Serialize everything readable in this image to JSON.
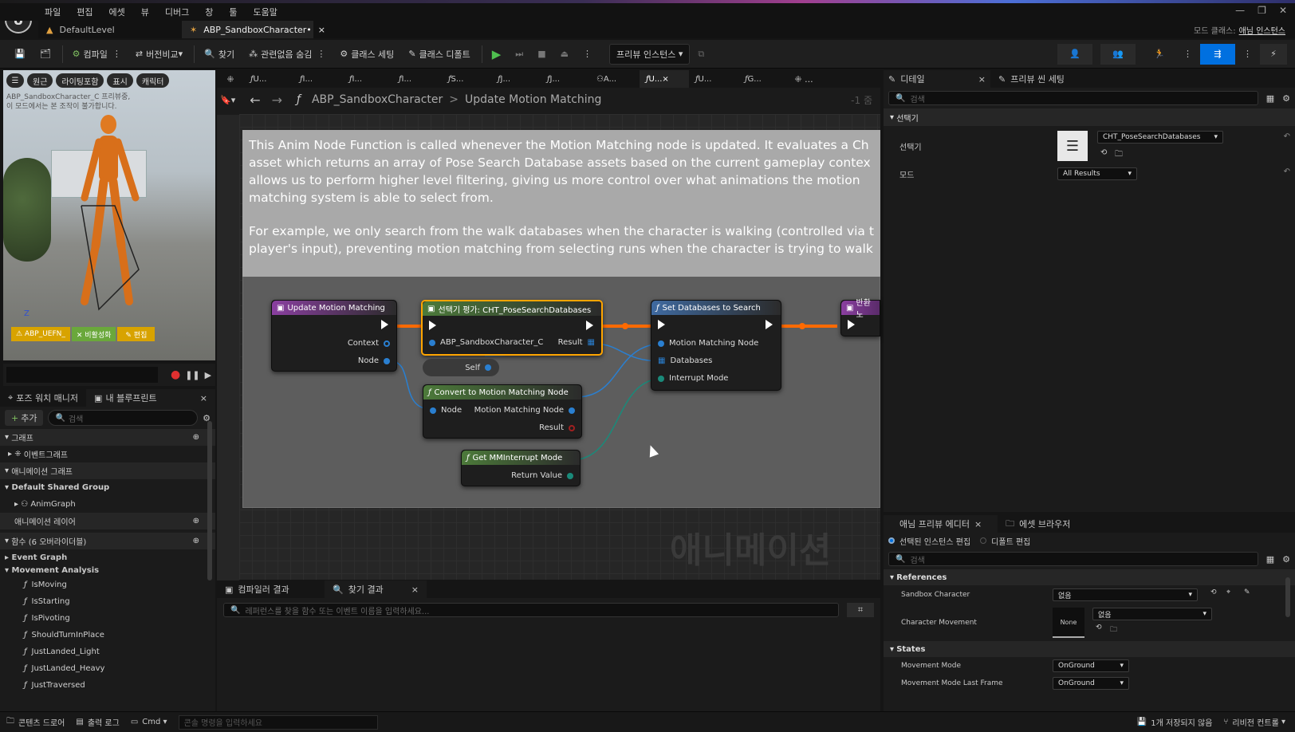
{
  "menu": [
    "파일",
    "편집",
    "에셋",
    "뷰",
    "디버그",
    "창",
    "툴",
    "도움말"
  ],
  "tabs": {
    "level": "DefaultLevel",
    "asset": "ABP_SandboxCharacter•",
    "close": "×"
  },
  "top_right": {
    "mode_label": "모드 클래스:",
    "mode_value": "애님 인스턴스"
  },
  "toolbar": {
    "compile": "컴파일",
    "diff": "버전비교",
    "find": "찾기",
    "hide_unrelated": "관련없음 숨김",
    "class_settings": "클래스 세팅",
    "class_defaults": "클래스 디폴트",
    "preview_instance": "프리뷰 인스턴스"
  },
  "viewport": {
    "chips": [
      "원근",
      "라이팅포함",
      "표시",
      "캐릭터"
    ],
    "info_line1": "ABP_SandboxCharacter_C 프리뷰중,",
    "info_line2": "이 모드에서는 본 조작이 불가합니다.",
    "axis": "Z",
    "btn_instance": "⚠ ABP_UEFN_",
    "btn_disable": "✕ 비활성화",
    "btn_edit": "✎ 편집"
  },
  "left_panel": {
    "tab_pose_watch": "포즈 워치 매니저",
    "tab_my_blueprint": "내 블루프린트",
    "add_button": "추가",
    "search_placeholder": "검색",
    "sections": {
      "graphs": "그래프",
      "event_graph": "이벤트그래프",
      "anim_graphs": "애니메이션 그래프",
      "default_shared_group": "Default Shared Group",
      "anim_graph": "AnimGraph",
      "anim_layers": "애니메이션 레이어",
      "functions": "함수 (6 오버라이더블)",
      "event_graph_cat": "Event Graph",
      "movement_analysis": "Movement Analysis"
    },
    "functions": [
      "IsMoving",
      "IsStarting",
      "IsPivoting",
      "ShouldTurnInPlace",
      "JustLanded_Light",
      "JustLanded_Heavy",
      "JustTraversed"
    ]
  },
  "graph_tabs": [
    "U...",
    "I...",
    "I...",
    "I...",
    "S...",
    "J...",
    "J...",
    "A...",
    "U...",
    "U...",
    "G..."
  ],
  "breadcrumb": {
    "asset": "ABP_SandboxCharacter",
    "sep": ">",
    "function": "Update Motion Matching",
    "zoom": "-1 줌"
  },
  "comment": {
    "para1_l1": "This Anim Node Function is called whenever the Motion Matching node is updated. It evaluates a Ch",
    "para1_l2": "asset which returns an array of Pose Search Database assets based on the current gameplay contex",
    "para1_l3": "allows us to perform higher level filtering, giving us more control over what animations the motion",
    "para1_l4": "matching system is able to select from.",
    "para2_l1": "For example, we only search from the walk databases when the character is walking (controlled via t",
    "para2_l2": "player's input), preventing motion matching from selecting runs when the character is trying to walk",
    "watermark": "애니메이션"
  },
  "nodes": {
    "entry": {
      "title": "Update Motion Matching",
      "pin_context": "Context",
      "pin_node": "Node"
    },
    "chooser": {
      "title": "선택기 평가: CHT_PoseSearchDatabases",
      "pin_target": "ABP_SandboxCharacter_C",
      "pin_result": "Result"
    },
    "self": {
      "title": "Self"
    },
    "convert": {
      "title": "Convert to Motion Matching Node",
      "pin_node": "Node",
      "pin_mm": "Motion Matching Node",
      "pin_result": "Result"
    },
    "get_interrupt": {
      "title": "Get MMInterrupt Mode",
      "pin_return": "Return Value"
    },
    "set_db": {
      "title": "Set Databases to Search",
      "pin_mm": "Motion Matching Node",
      "pin_db": "Databases",
      "pin_interrupt": "Interrupt Mode"
    },
    "return": {
      "title": "반환 노"
    }
  },
  "bottom": {
    "tab_compile": "컴파일러 결과",
    "tab_find": "찾기 결과",
    "find_placeholder": "레퍼런스를 찾을 함수 또는 이벤트 이름을 입력하세요..."
  },
  "details": {
    "tab_details": "디테일",
    "tab_preview_scene": "프리뷰 씬 세팅",
    "search": "검색",
    "section_chooser": "선택기",
    "label_chooser": "선택기",
    "chooser_value": "CHT_PoseSearchDatabases",
    "label_mode": "모드",
    "mode_value": "All Results"
  },
  "anim_preview": {
    "tab_editor": "애님 프리뷰 에디터",
    "tab_browser": "에셋 브라우저",
    "radio_selected": "선택된 인스턴스 편집",
    "radio_defaults": "디폴트 편집",
    "search": "검색",
    "section_refs": "References",
    "sandbox_label": "Sandbox Character",
    "sandbox_value": "없음",
    "movement_label": "Character Movement",
    "movement_value": "없음",
    "thumb_none": "None",
    "section_states": "States",
    "mode_label": "Movement Mode",
    "mode_value": "OnGround",
    "mode_last_label": "Movement Mode Last Frame",
    "mode_last_value": "OnGround"
  },
  "status": {
    "content_drawer": "콘텐츠 드로어",
    "output_log": "출력 로그",
    "cmd": "Cmd",
    "console_placeholder": "콘솔 명령을 입력하세요",
    "unsaved": "1개 저장되지 않음",
    "revision": "리비전 컨트롤"
  },
  "colors": {
    "accent": "#0070e0",
    "exec": "#ffffff",
    "orange_wire": "#ff6a00",
    "func_header": "#3f5a7c",
    "pure_header": "#4c6a3f",
    "chooser_border": "#ffa500"
  }
}
